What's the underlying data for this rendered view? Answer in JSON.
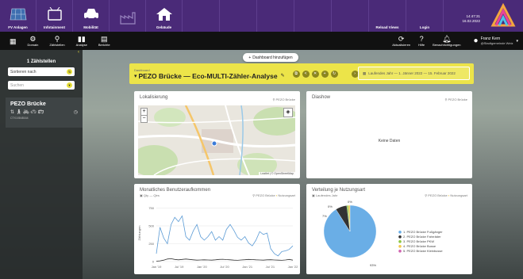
{
  "topnav": {
    "items": [
      {
        "label": "FV Anlagen",
        "icon": "solar-panel-icon",
        "active": true
      },
      {
        "label": "Infotainment",
        "icon": "tv-icon",
        "active": true
      },
      {
        "label": "Mobilität",
        "icon": "car-icon",
        "active": true
      },
      {
        "label": "",
        "icon": "factory-icon",
        "active": false
      },
      {
        "label": "Gebäude",
        "icon": "building-icon",
        "active": true
      }
    ],
    "cells": [
      "",
      "",
      "",
      "",
      "",
      "Reload Views",
      "Login"
    ],
    "time": "14:47:31",
    "date": "16.02.2022"
  },
  "toolbar": {
    "left": [
      {
        "label": "",
        "icon": "apps-grid-icon"
      },
      {
        "label": "Domain",
        "icon": "domain-icon"
      },
      {
        "label": "Zählstellen",
        "icon": "location-pin-icon"
      },
      {
        "label": "Analyse",
        "icon": "bar-chart-icon"
      },
      {
        "label": "Berichte",
        "icon": "document-icon"
      }
    ],
    "right": [
      {
        "label": "Aktualisieren",
        "icon": "refresh-icon"
      },
      {
        "label": "Hilfe",
        "icon": "help-icon"
      },
      {
        "label": "Benachrichtigungen",
        "icon": "bell-icon"
      }
    ],
    "user_name": "Franz Kern",
    "user_sub": "@Stadtgemeinde Weiz"
  },
  "sidebar": {
    "title": "1 Zählstellen",
    "sort_label": "Sortieren nach",
    "search_placeholder": "Suchen",
    "card": {
      "title": "PEZO Brücke",
      "id": "CTX10848164"
    }
  },
  "dashboard": {
    "add_label": "Dashboard hinzufügen",
    "small_label": "Dashboard",
    "title": "PEZO Brücke — Eco-MULTI-Zähler-Analyse",
    "date_range": "Laufendes Jahr  —  1. Jänner 2022 — 15. Februar 2022"
  },
  "panels": {
    "map": {
      "title": "Lokalisierung",
      "tag": "PEZO Brücke",
      "attribution": "Leaflet | © OpenStreetMap"
    },
    "diashow": {
      "title": "Diashow",
      "tag": "PEZO Brücke",
      "empty": "Keine Daten"
    },
    "monthly": {
      "title": "Monatliches Benutzeraufkommen",
      "sub": "Qty — Qtrs",
      "tag1": "PEZO Brücke",
      "tag2": "Nutzungsart"
    },
    "share": {
      "title": "Verteilung je Nutzungsart",
      "sub": "Laufendes Jahr",
      "tag1": "PEZO Brücke",
      "tag2": "Nutzungsart"
    }
  },
  "chart_data": [
    {
      "type": "line",
      "ylabel": "Zählungen",
      "ylim": [
        0,
        800
      ],
      "yticks": [
        "0",
        "250",
        "500",
        "750"
      ],
      "xticks": [
        "Jan '19",
        "Jul '19",
        "Jan '20",
        "Jul '20",
        "Jan '21",
        "Jul '21",
        "Jan '22"
      ],
      "grid": true,
      "series": [
        {
          "name": "",
          "color": "#5b9bd5",
          "values": [
            110,
            480,
            330,
            250,
            520,
            620,
            560,
            640,
            350,
            300,
            430,
            520,
            350,
            300,
            350,
            420,
            300,
            350,
            300,
            450,
            520,
            440,
            340,
            300,
            350,
            260,
            220,
            300,
            420,
            380,
            400,
            180,
            110,
            80,
            140,
            150,
            170,
            220
          ]
        },
        {
          "name": "",
          "color": "#333333",
          "values": [
            5,
            10,
            20,
            35,
            40,
            30,
            25,
            30,
            35,
            30,
            25,
            20,
            22,
            24,
            22,
            20,
            25,
            30,
            32,
            28,
            24,
            20,
            18,
            22,
            26,
            30,
            28,
            24,
            22,
            20,
            24,
            26,
            22,
            20,
            18,
            22,
            30,
            20
          ]
        }
      ]
    },
    {
      "type": "pie",
      "slices": [
        {
          "label": "1. PEZO Brücke Fußgänger",
          "pct": 91,
          "color": "#6aaee6"
        },
        {
          "label": "2. PEZO Brücke Fahrräder",
          "pct": 7,
          "color": "#333333"
        },
        {
          "label": "3. PEZO Brücke PKW",
          "pct": 1,
          "color": "#8cc63f"
        },
        {
          "label": "4. PEZO Brücke Busse",
          "pct": 1,
          "color": "#f2c84b"
        },
        {
          "label": "5. PEZO Brücke Kleinbusse",
          "pct": 0,
          "color": "#d063b0"
        }
      ],
      "labels": [
        "0%",
        "0%",
        "7%",
        "93%"
      ]
    }
  ]
}
